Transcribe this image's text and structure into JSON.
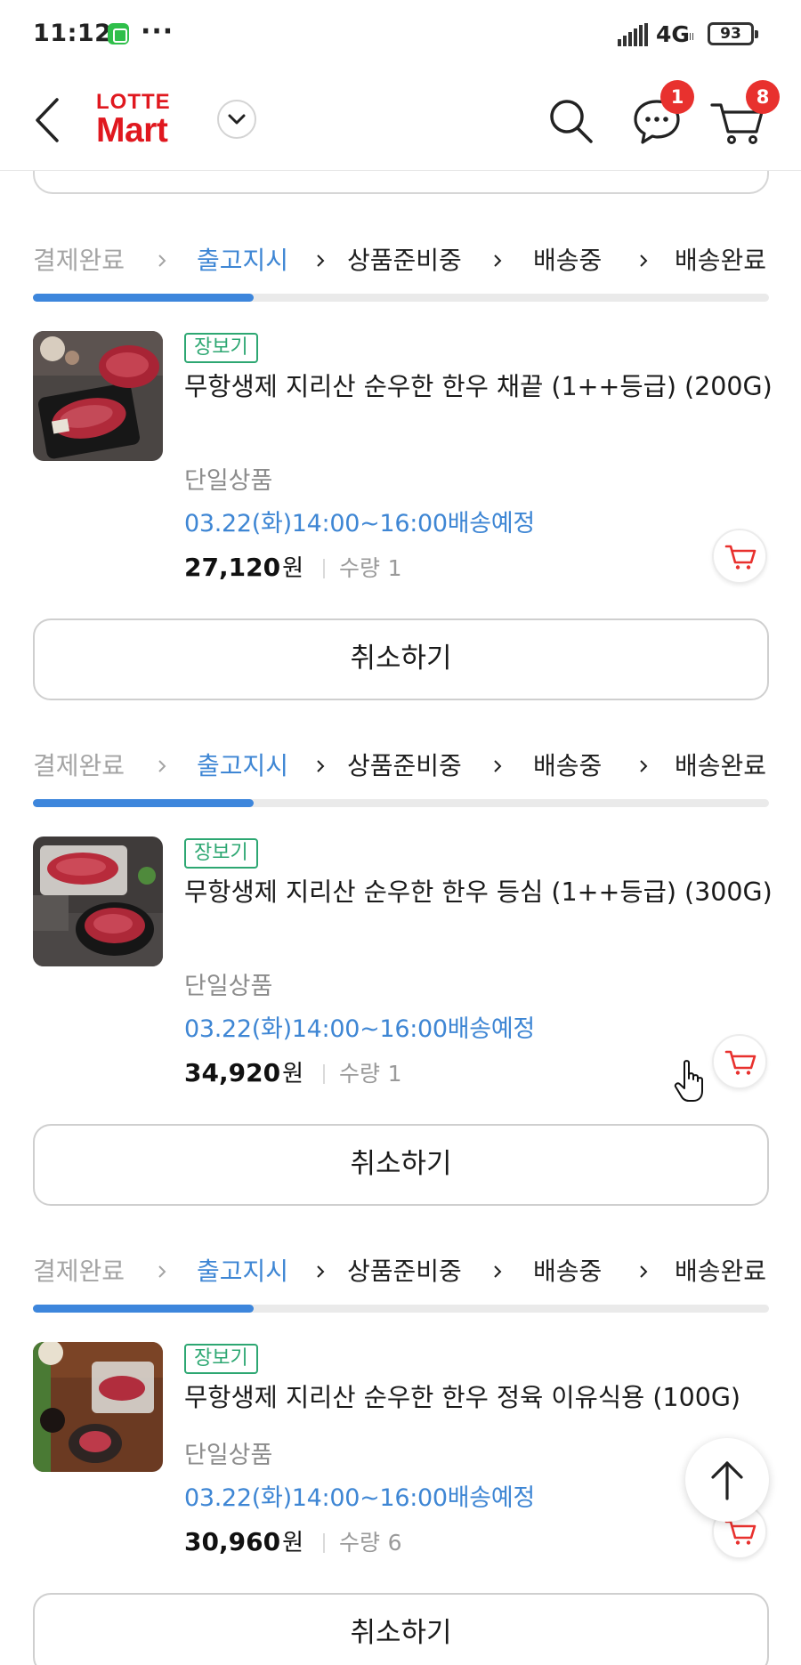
{
  "status_bar": {
    "time": "11:12",
    "more": "···",
    "network": "4G",
    "network_sub": "ll",
    "battery": "93"
  },
  "header": {
    "logo_top": "LOTTE",
    "logo_bottom": "Mart",
    "chat_badge": "1",
    "cart_badge": "8",
    "brand_color": "#e0181f",
    "icons": [
      "back-arrow-icon",
      "chevron-down-icon",
      "search-icon",
      "chat-bubble-icon",
      "cart-icon"
    ]
  },
  "steps": [
    "결제완료",
    "출고지시",
    "상품준비중",
    "배송중",
    "배송완료"
  ],
  "orders": [
    {
      "current_step_index": 1,
      "progress_fraction": 0.3,
      "tag": "장보기",
      "name": "무항생제 지리산 순우한 한우 채끝 (1++등급) (200G)",
      "option": "단일상품",
      "delivery": "03.22(화)14:00~16:00배송예정",
      "price": "27,120",
      "currency": "원",
      "qty_label": "수량",
      "qty": "1",
      "cancel_label": "취소하기"
    },
    {
      "current_step_index": 1,
      "progress_fraction": 0.3,
      "tag": "장보기",
      "name": "무항생제 지리산 순우한 한우 등심 (1++등급) (300G)",
      "option": "단일상품",
      "delivery": "03.22(화)14:00~16:00배송예정",
      "price": "34,920",
      "currency": "원",
      "qty_label": "수량",
      "qty": "1",
      "cancel_label": "취소하기"
    },
    {
      "current_step_index": 1,
      "progress_fraction": 0.3,
      "tag": "장보기",
      "name": "무항생제 지리산 순우한 한우 정육 이유식용 (100G)",
      "option": "단일상품",
      "delivery": "03.22(화)14:00~16:00배송예정",
      "price": "30,960",
      "currency": "원",
      "qty_label": "수량",
      "qty": "6",
      "cancel_label": "취소하기"
    }
  ],
  "colors": {
    "active_step": "#3e86d4",
    "progress": "#3d86dc",
    "tag": "#2da772",
    "badge": "#e8312e"
  }
}
